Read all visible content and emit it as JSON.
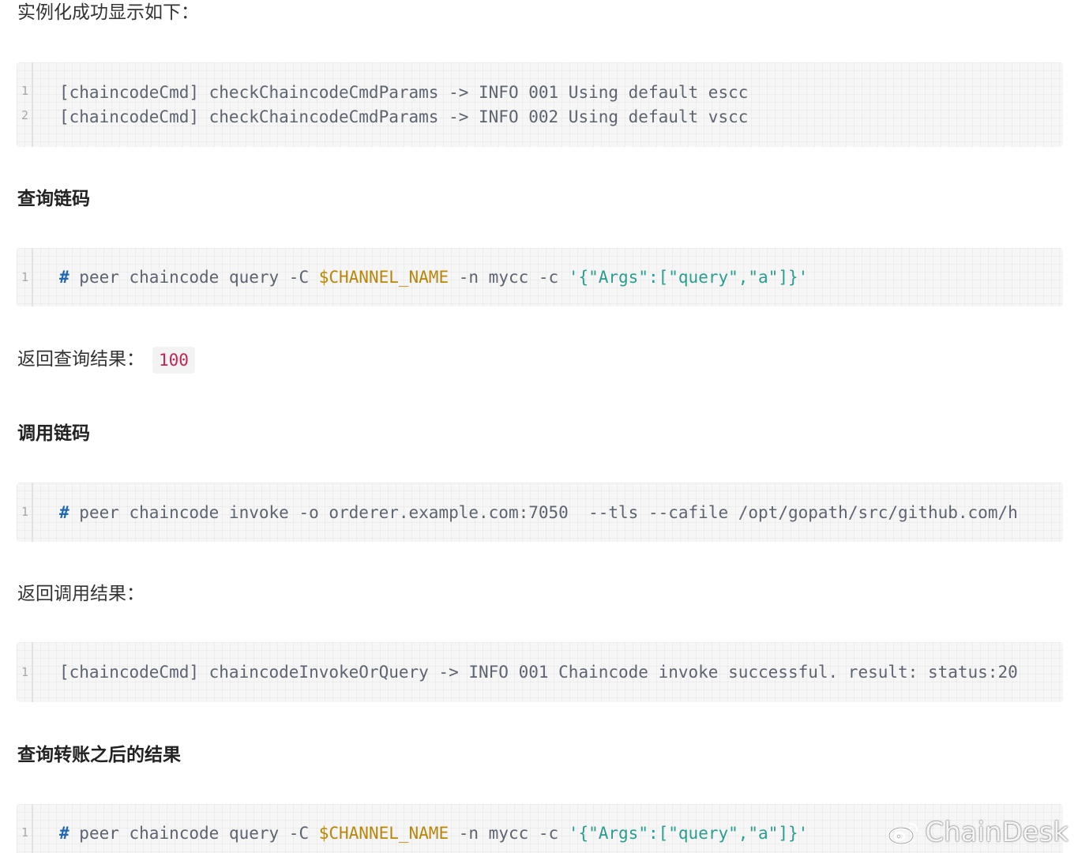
{
  "intro_text": "实例化成功显示如下：",
  "block1": {
    "lines": [
      {
        "num": "1",
        "text": "[chaincodeCmd] checkChaincodeCmdParams -> INFO 001 Using default escc"
      },
      {
        "num": "2",
        "text": "[chaincodeCmd] checkChaincodeCmdParams -> INFO 002 Using default vscc"
      }
    ]
  },
  "heading_query": "查询链码",
  "block2": {
    "num": "1",
    "hash": "#",
    "cmd": " peer chaincode query -C ",
    "var": "$CHANNEL_NAME",
    "cmd2": " -n mycc -c ",
    "arg": "'{\"Args\":[\"query\",\"a\"]}'"
  },
  "query_result": {
    "label": "返回查询结果：",
    "value": "100"
  },
  "heading_invoke": "调用链码",
  "block3": {
    "num": "1",
    "hash": "#",
    "cmd": " peer chaincode invoke -o orderer.example.com:7050  --tls --cafile /opt/gopath/src/github.com/h"
  },
  "invoke_result_label": "返回调用结果：",
  "block4": {
    "num": "1",
    "text": "[chaincodeCmd] chaincodeInvokeOrQuery -> INFO 001 Chaincode invoke successful. result: status:20"
  },
  "heading_after": "查询转账之后的结果",
  "block5": {
    "num": "1",
    "hash": "#",
    "cmd": " peer chaincode query -C ",
    "var": "$CHANNEL_NAME",
    "cmd2": " -n mycc -c ",
    "arg": "'{\"Args\":[\"query\",\"a\"]}'"
  },
  "watermark": {
    "icon": "weibo-icon",
    "text": "ChainDesk"
  },
  "colors": {
    "comment": "#1f66b3",
    "variable": "#b8860b",
    "string": "#2a9d8f",
    "inline_code": "#c7254e",
    "code_bg": "#f6f6f6"
  }
}
